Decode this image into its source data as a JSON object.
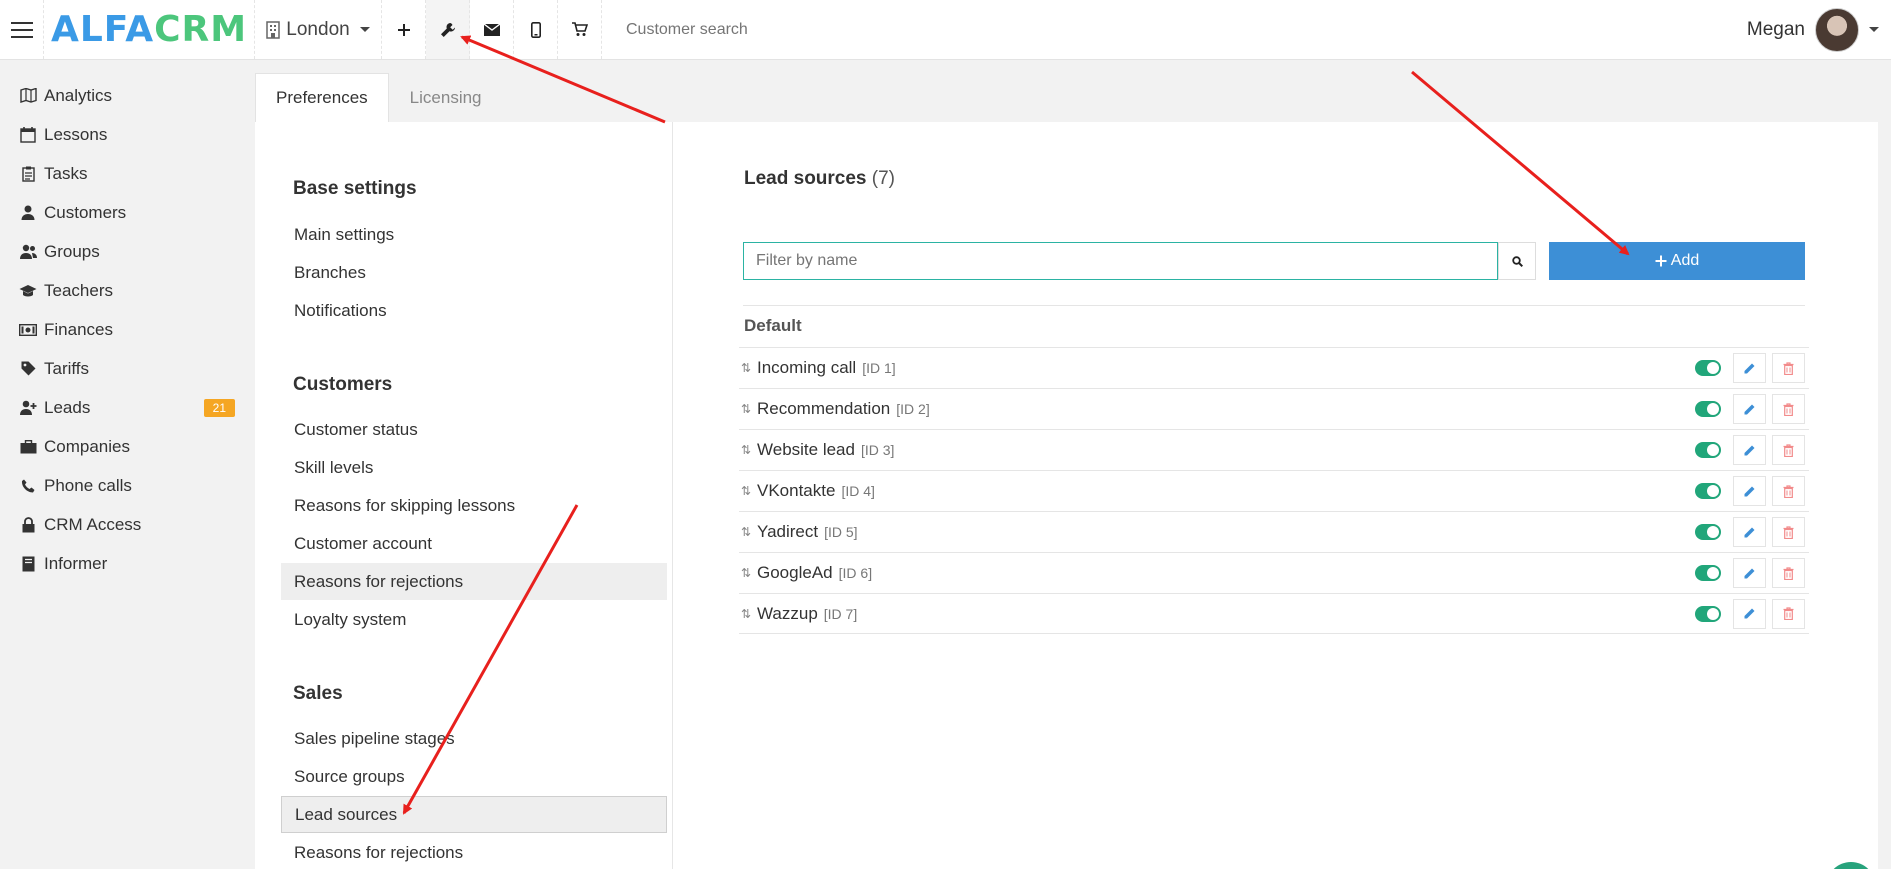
{
  "topbar": {
    "logo_part1": "ALFA",
    "logo_part2": "CRM",
    "branch": "London",
    "icons": [
      "plus-icon",
      "wrench-icon",
      "mail-icon",
      "mobile-icon",
      "cart-icon"
    ],
    "search_placeholder": "Customer search",
    "user_name": "Megan"
  },
  "sidebar": {
    "items": [
      {
        "label": "Analytics",
        "icon": "map-icon"
      },
      {
        "label": "Lessons",
        "icon": "calendar-icon"
      },
      {
        "label": "Tasks",
        "icon": "clipboard-icon"
      },
      {
        "label": "Customers",
        "icon": "user-icon"
      },
      {
        "label": "Groups",
        "icon": "users-icon"
      },
      {
        "label": "Teachers",
        "icon": "graduation-cap-icon"
      },
      {
        "label": "Finances",
        "icon": "money-icon"
      },
      {
        "label": "Tariffs",
        "icon": "tag-icon"
      },
      {
        "label": "Leads",
        "icon": "user-plus-icon",
        "badge": "21"
      },
      {
        "label": "Companies",
        "icon": "briefcase-icon"
      },
      {
        "label": "Phone calls",
        "icon": "phone-icon"
      },
      {
        "label": "CRM Access",
        "icon": "lock-icon"
      },
      {
        "label": "Informer",
        "icon": "book-icon"
      }
    ]
  },
  "tabs": [
    "Preferences",
    "Licensing"
  ],
  "menu": {
    "sections": [
      {
        "title": "Base settings",
        "links": [
          "Main settings",
          "Branches",
          "Notifications"
        ]
      },
      {
        "title": "Customers",
        "links": [
          "Customer status",
          "Skill levels",
          "Reasons for skipping lessons",
          "Customer account",
          "Reasons for rejections",
          "Loyalty system"
        ]
      },
      {
        "title": "Sales",
        "links": [
          "Sales pipeline stages",
          "Source groups",
          "Lead sources",
          "Reasons for rejections"
        ]
      }
    ]
  },
  "content": {
    "title": "Lead sources",
    "count": "(7)",
    "filter_placeholder": "Filter by name",
    "add_label": "Add",
    "group_label": "Default",
    "rows": [
      {
        "name": "Incoming call",
        "id": "[ID 1]"
      },
      {
        "name": "Recommendation",
        "id": "[ID 2]"
      },
      {
        "name": "Website lead",
        "id": "[ID 3]"
      },
      {
        "name": "VKontakte",
        "id": "[ID 4]"
      },
      {
        "name": "Yadirect",
        "id": "[ID 5]"
      },
      {
        "name": "GoogleAd",
        "id": "[ID 6]"
      },
      {
        "name": "Wazzup",
        "id": "[ID 7]"
      }
    ]
  },
  "colors": {
    "accent_blue": "#3d8fd6",
    "toggle_green": "#21a67a",
    "badge_orange": "#f5a623",
    "arrow_red": "#e8201d",
    "logo_blue": "#3a9ae6",
    "logo_green": "#4cc67c"
  }
}
